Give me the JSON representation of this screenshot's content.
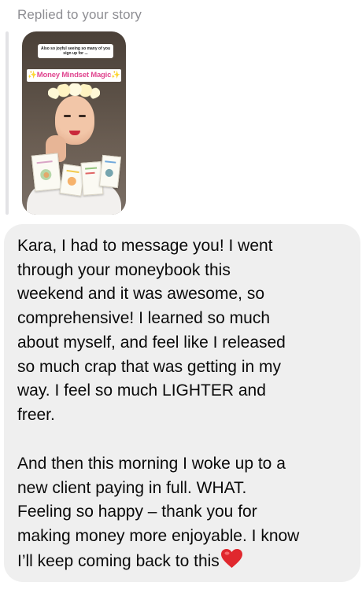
{
  "reply_header": "Replied to your story",
  "story": {
    "caption": "Also so joyful seeing so many of you sign up for ...",
    "title": "✨Money Mindset Magic✨",
    "thumbnail_label": "story-thumbnail"
  },
  "message": {
    "paragraph_1": "Kara, I had to message you! I went\nthrough your moneybook this\nweekend and it was awesome, so\ncomprehensive! I learned so much\nabout myself, and feel like I released\nso much crap that was getting in my\nway. I feel so much LIGHTER and\nfreer.",
    "paragraph_2": "And then this morning I woke up to a\nnew client paying in full. WHAT.\nFeeling so happy – thank you for\nmaking money more enjoyable. I know\nI’ll keep coming back to this",
    "emoji": "red-heart-icon"
  },
  "colors": {
    "bubble": "#efefef",
    "header_text": "#8e8e93",
    "heart": "#e0282e",
    "title_pink": "#e0458f"
  }
}
